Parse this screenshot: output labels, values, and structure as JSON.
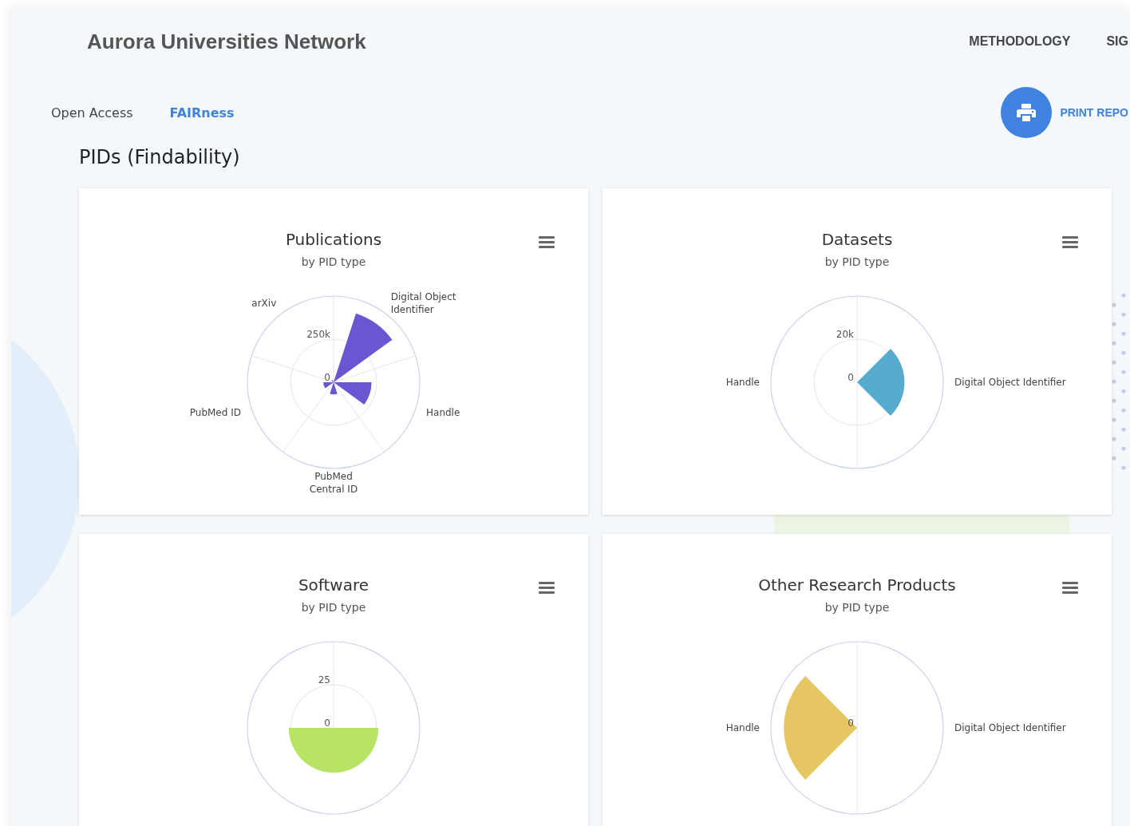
{
  "header": {
    "title": "Aurora Universities Network",
    "nav": [
      {
        "label": "METHODOLOGY"
      },
      {
        "label": "SIG"
      }
    ]
  },
  "tabs": [
    {
      "label": "Open Access",
      "selected": false
    },
    {
      "label": "FAIRness",
      "selected": true
    }
  ],
  "print_button": {
    "label": "PRINT REPO"
  },
  "section_title": "PIDs (Findability)",
  "cards": [
    {
      "title": "Publications",
      "subtitle": "by PID type",
      "color": "#6a56d1",
      "ticks": [
        "250k",
        "0"
      ],
      "labels": [
        "Digital Object Identifier",
        "Handle",
        "PubMed Central ID",
        "PubMed ID",
        "arXiv"
      ]
    },
    {
      "title": "Datasets",
      "subtitle": "by PID type",
      "color": "#57abcd",
      "ticks": [
        "20k",
        "0"
      ],
      "labels": [
        "Handle",
        "Digital Object Identifier"
      ]
    },
    {
      "title": "Software",
      "subtitle": "by PID type",
      "color": "#b8e466",
      "ticks": [
        "25",
        "0"
      ]
    },
    {
      "title": "Other Research Products",
      "subtitle": "by PID type",
      "color": "#e5c663",
      "ticks": [
        "0"
      ],
      "labels": [
        "Handle",
        "Digital Object Identifier"
      ]
    }
  ]
}
